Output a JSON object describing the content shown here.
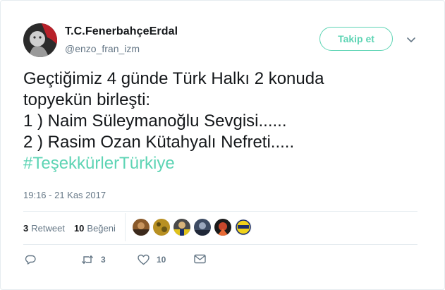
{
  "user": {
    "display_name": "T.C.FenerbahçeErdal",
    "handle": "@enzo_fran_izm"
  },
  "follow_button": {
    "label": "Takip et"
  },
  "tweet": {
    "lines": [
      "Geçtiğimiz 4 günde Türk Halkı 2 konuda",
      "topyekün birleşti:",
      "1 ) Naim Süleymanoğlu Sevgisi......",
      "2 ) Rasim Ozan Kütahyalı Nefreti....."
    ],
    "hashtag": "#TeşekkürlerTürkiye",
    "timestamp": "19:16 - 21 Kas 2017"
  },
  "stats": {
    "retweet_count": "3",
    "retweet_label": "Retweet",
    "like_count": "10",
    "like_label": "Beğeni"
  },
  "actions": {
    "reply_count": "",
    "retweet_count": "3",
    "like_count": "10"
  },
  "colors": {
    "accent": "#5dd4b4",
    "text": "#14171a",
    "muted": "#657786",
    "border": "#e6ecf0"
  },
  "icons": {
    "reply": "reply-icon",
    "retweet": "retweet-icon",
    "like": "heart-icon",
    "message": "envelope-icon",
    "caret": "chevron-down-icon"
  }
}
